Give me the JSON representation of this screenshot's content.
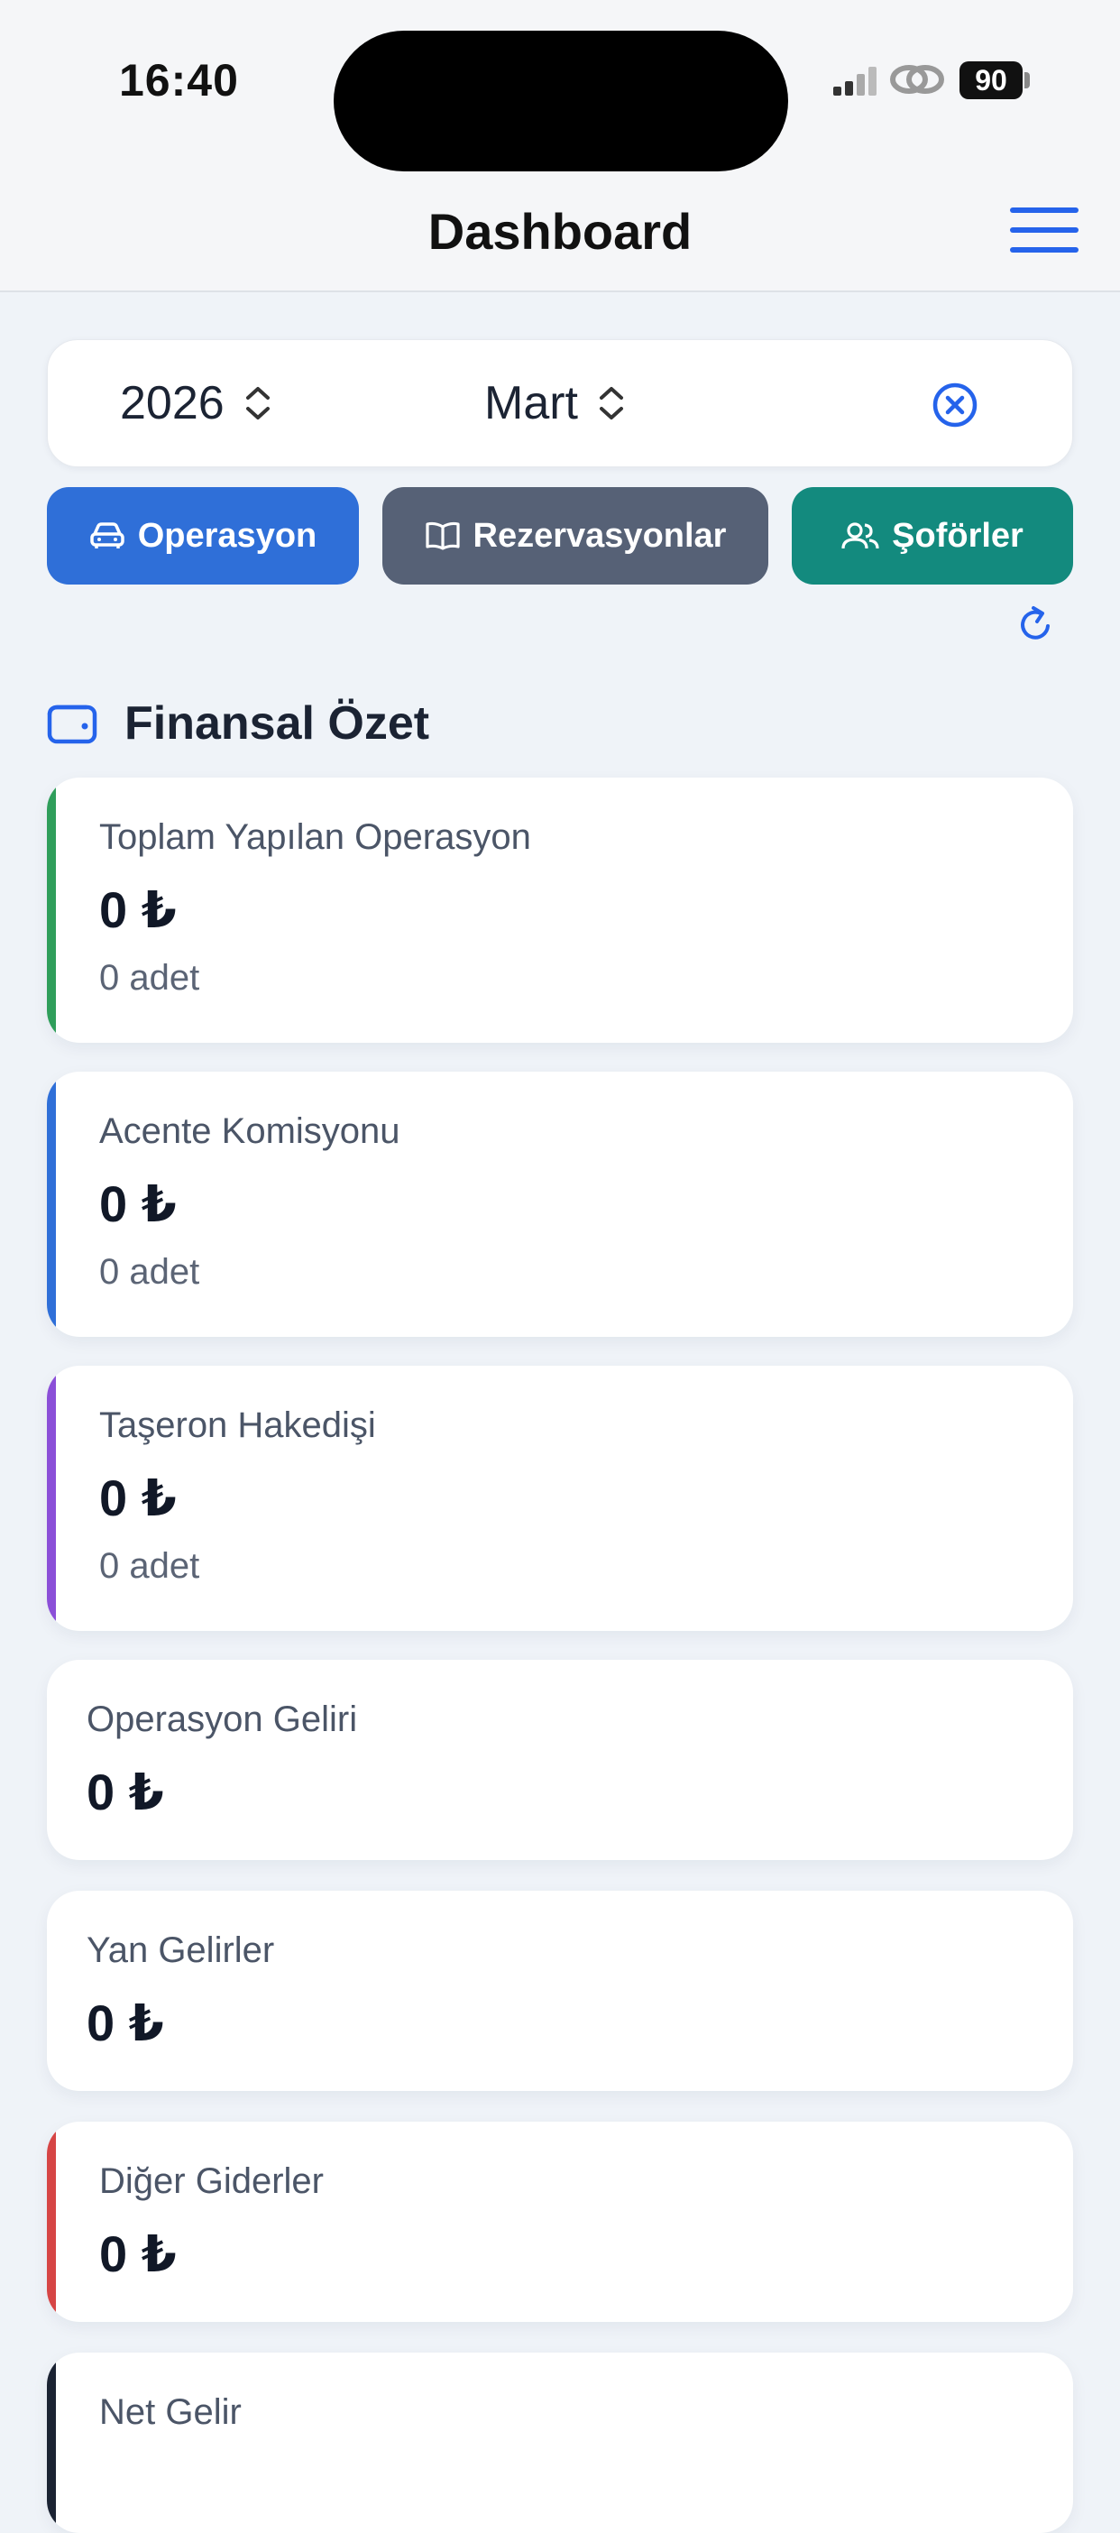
{
  "status_bar": {
    "time": "16:40",
    "battery": "90"
  },
  "header": {
    "title": "Dashboard"
  },
  "filters": {
    "year": "2026",
    "month": "Mart"
  },
  "actions": [
    {
      "label": "Operasyon",
      "color": "#2f6fd8",
      "icon": "car-icon"
    },
    {
      "label": "Rezervasyonlar",
      "color": "#566176",
      "icon": "book-icon"
    },
    {
      "label": "Şoförler",
      "color": "#138a7e",
      "icon": "users-icon"
    }
  ],
  "section": {
    "title": "Finansal Özet",
    "icon": "wallet-icon"
  },
  "cards": [
    {
      "label": "Toplam Yapılan Operasyon",
      "amount": "0 ₺",
      "count": "0 adet",
      "accent": "#2f9e5b"
    },
    {
      "label": "Acente Komisyonu",
      "amount": "0 ₺",
      "count": "0 adet",
      "accent": "#2f6fd8"
    },
    {
      "label": "Taşeron Hakedişi",
      "amount": "0 ₺",
      "count": "0 adet",
      "accent": "#8b4fd8"
    },
    {
      "label": "Operasyon Geliri",
      "amount": "0 ₺"
    },
    {
      "label": "Yan Gelirler",
      "amount": "0 ₺"
    },
    {
      "label": "Diğer Giderler",
      "amount": "0 ₺",
      "accent": "#d64545"
    },
    {
      "label": "Net Gelir",
      "accent": "#1b2333"
    }
  ]
}
